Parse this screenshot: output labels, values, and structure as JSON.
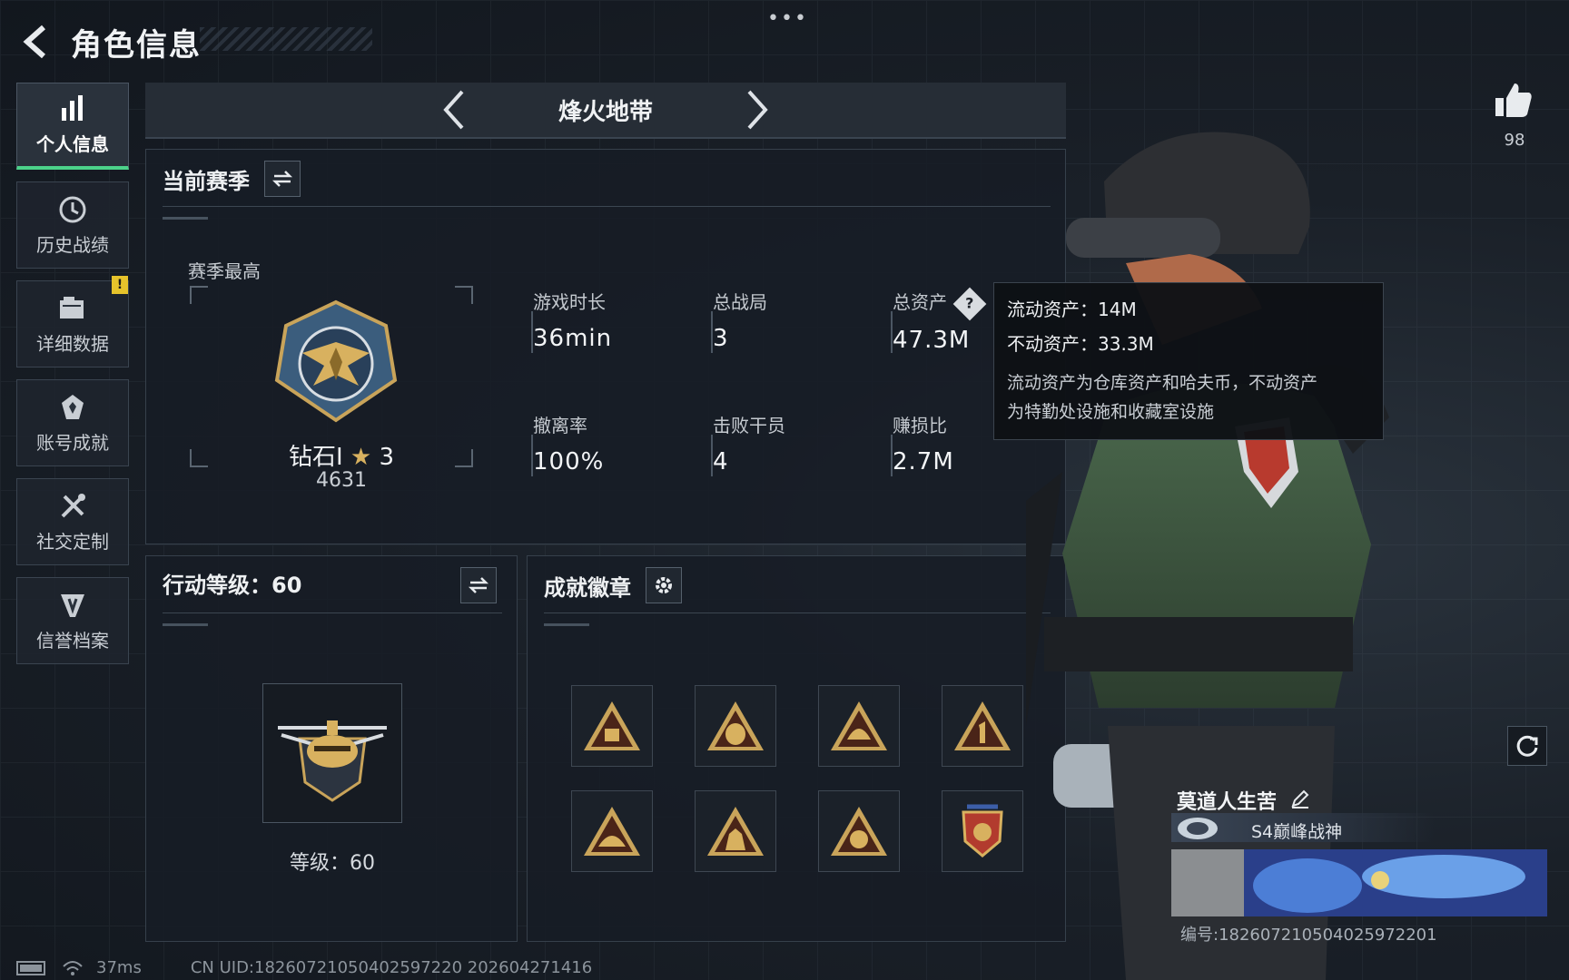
{
  "header": {
    "title": "角色信息",
    "menu_dots": "•••"
  },
  "sidebar": {
    "items": [
      {
        "label": "个人信息",
        "icon": "bar-chart-icon",
        "active": true
      },
      {
        "label": "历史战绩",
        "icon": "history-clock-icon"
      },
      {
        "label": "详细数据",
        "icon": "folder-icon",
        "badge": "!"
      },
      {
        "label": "账号成就",
        "icon": "achievement-icon"
      },
      {
        "label": "社交定制",
        "icon": "tools-icon"
      },
      {
        "label": "信誉档案",
        "icon": "credit-shield-icon"
      }
    ]
  },
  "mode": {
    "title": "烽火地带"
  },
  "season": {
    "title": "当前赛季",
    "best_label": "赛季最高",
    "rank_name": "钻石I",
    "rank_stars": "3",
    "rank_score": "4631",
    "stats": [
      {
        "key": "游戏时长",
        "value": "36min"
      },
      {
        "key": "总战局",
        "value": "3"
      },
      {
        "key": "总资产",
        "value": "47.3M"
      },
      {
        "key": "撤离率",
        "value": "100%"
      },
      {
        "key": "击败干员",
        "value": "4"
      },
      {
        "key": "赚损比",
        "value": "2.7M"
      }
    ],
    "help_icon": "?"
  },
  "tooltip": {
    "liquid": "流动资产：14M",
    "fixed": "不动资产：33.3M",
    "desc_line1": "流动资产为仓库资产和哈夫币，不动资产",
    "desc_line2": "为特勤处设施和收藏室设施"
  },
  "action_level": {
    "title": "行动等级：60",
    "level_label": "等级：60"
  },
  "achievements": {
    "title": "成就徽章",
    "badges": [
      "rucksack-badge-icon",
      "backpack-55-badge-icon",
      "helmet-56-badge-icon",
      "number-1-badge-icon",
      "helmet-badge-icon",
      "squad-badge-icon",
      "skull-badge-icon",
      "shield-medal-badge-icon"
    ]
  },
  "profile": {
    "likes": "98",
    "player_name": "莫道人生苦",
    "title_text": "S4巅峰战神",
    "uid": "编号:182607210504025972201"
  },
  "footer": {
    "ping": "37ms",
    "uid_line": "CN UID:1826072105040259722​0 202604271416"
  },
  "colors": {
    "accent_green": "#4cd28a",
    "warning_yellow": "#e6c32b",
    "panel_bg": "#171d25"
  }
}
